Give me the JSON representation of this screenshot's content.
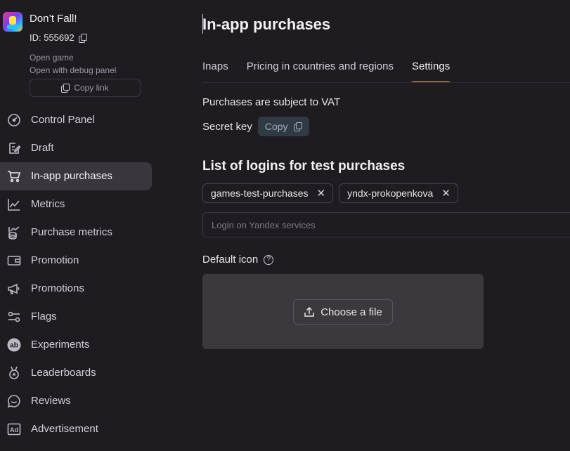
{
  "app": {
    "name": "Don’t Fall!",
    "id_text": "ID: 555692",
    "open_game": "Open game",
    "open_debug": "Open with debug panel",
    "copy_link": "Copy link"
  },
  "nav": [
    {
      "label": "Control Panel",
      "icon": "speedometer-icon"
    },
    {
      "label": "Draft",
      "icon": "edit-document-icon"
    },
    {
      "label": "In-app purchases",
      "icon": "cart-icon",
      "active": true
    },
    {
      "label": "Metrics",
      "icon": "line-chart-icon"
    },
    {
      "label": "Purchase metrics",
      "icon": "coins-chart-icon"
    },
    {
      "label": "Promotion",
      "icon": "wallet-icon"
    },
    {
      "label": "Promotions",
      "icon": "megaphone-icon"
    },
    {
      "label": "Flags",
      "icon": "toggles-icon"
    },
    {
      "label": "Experiments",
      "icon": "ab-icon"
    },
    {
      "label": "Leaderboards",
      "icon": "medal-icon"
    },
    {
      "label": "Reviews",
      "icon": "chat-bubble-icon"
    },
    {
      "label": "Advertisement",
      "icon": "ad-icon"
    }
  ],
  "page": {
    "title": "In-app purchases",
    "tabs": [
      {
        "label": "Inaps"
      },
      {
        "label": "Pricing in countries and regions"
      },
      {
        "label": "Settings",
        "active": true
      }
    ],
    "vat_text": "Purchases are subject to VAT",
    "secret_key_label": "Secret key",
    "copy_label": "Copy",
    "test_logins_title": "List of logins for test purchases",
    "chips": [
      "games-test-purchases",
      "yndx-prokopenkova"
    ],
    "chip_remove": "✕",
    "login_placeholder": "Login on Yandex services",
    "default_icon_label": "Default icon",
    "help_glyph": "?",
    "choose_file": "Choose a file"
  },
  "colors": {
    "background": "#1e1b21",
    "active_nav": "#3a363d",
    "tab_underline": "#f3b07a",
    "copy_button_bg": "#2f3a45",
    "dropzone_bg": "#3b383e"
  }
}
